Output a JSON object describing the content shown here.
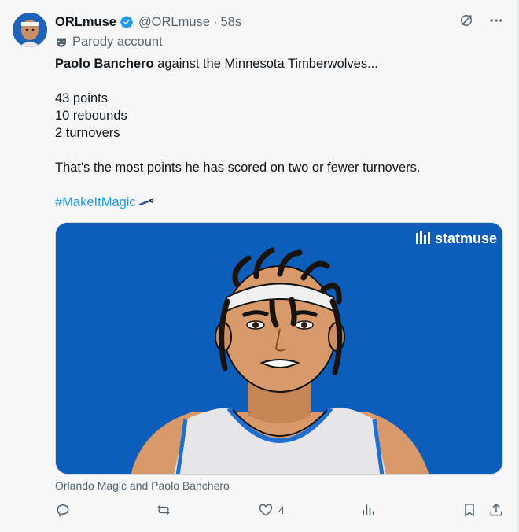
{
  "author": {
    "name": "ORLmuse",
    "handle": "@ORLmuse",
    "separator": "·",
    "time": "58s",
    "label": "Parody account",
    "verified_color": "#1d9bf0"
  },
  "post": {
    "player_name": "Paolo Banchero",
    "headline_rest": " against the Minnesota Timberwolves...",
    "stats": [
      "43 points",
      "10 rebounds",
      "2 turnovers"
    ],
    "summary": "That's the most points he has scored on two or fewer turnovers.",
    "hashtag": "#MakeItMagic"
  },
  "media": {
    "brand": "statmuse",
    "background": "#0d5dbb",
    "alt_caption": "Orlando Magic and Paolo Banchero"
  },
  "actions": {
    "reply_icon": "reply-icon",
    "repost_icon": "repost-icon",
    "like_icon": "heart-icon",
    "like_count": "4",
    "views_icon": "views-icon",
    "bookmark_icon": "bookmark-icon",
    "share_icon": "share-icon"
  },
  "header_icons": [
    "grok-icon",
    "more-icon"
  ]
}
